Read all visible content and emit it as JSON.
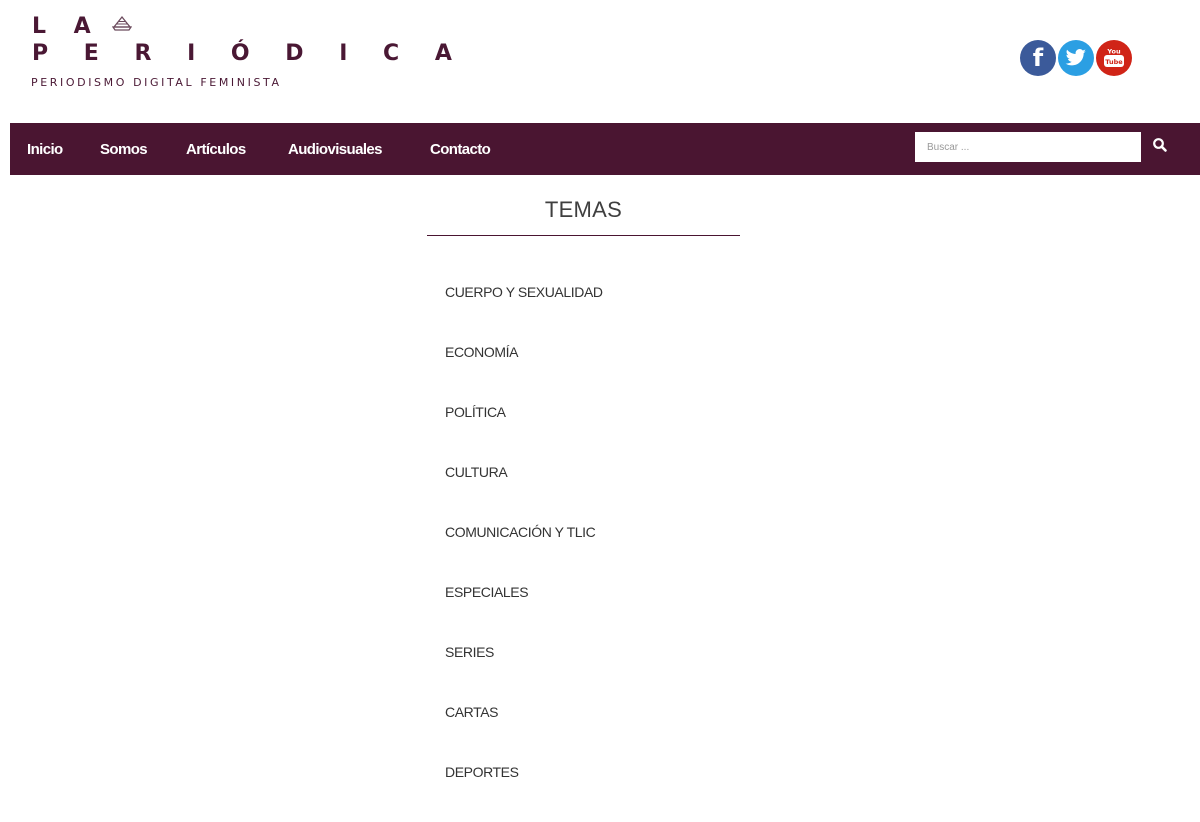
{
  "brand": {
    "line1": "L A",
    "line2": "P E R I Ó D I C A",
    "tagline": "PERIODISMO DIGITAL FEMINISTA",
    "color": "#4a1834"
  },
  "social": [
    {
      "name": "facebook",
      "icon": "facebook-icon",
      "glyph": "f",
      "color": "#3b5a9a"
    },
    {
      "name": "twitter",
      "icon": "twitter-icon",
      "color": "#2b9fe3"
    },
    {
      "name": "youtube",
      "icon": "youtube-icon",
      "label_top": "You",
      "label_bottom": "Tube",
      "color": "#d02417"
    }
  ],
  "nav": {
    "background": "#4a1531",
    "items": [
      "Inicio",
      "Somos",
      "Artículos",
      "Audiovisuales",
      "Contacto"
    ],
    "search_placeholder": "Buscar ...",
    "search_icon": "search-icon"
  },
  "main": {
    "title": "TEMAS",
    "topics": [
      "CUERPO Y SEXUALIDAD",
      "ECONOMÍA",
      "POLÍTICA",
      "CULTURA",
      "COMUNICACIÓN Y TLIC",
      "ESPECIALES",
      "SERIES",
      "CARTAS",
      "DEPORTES"
    ]
  }
}
